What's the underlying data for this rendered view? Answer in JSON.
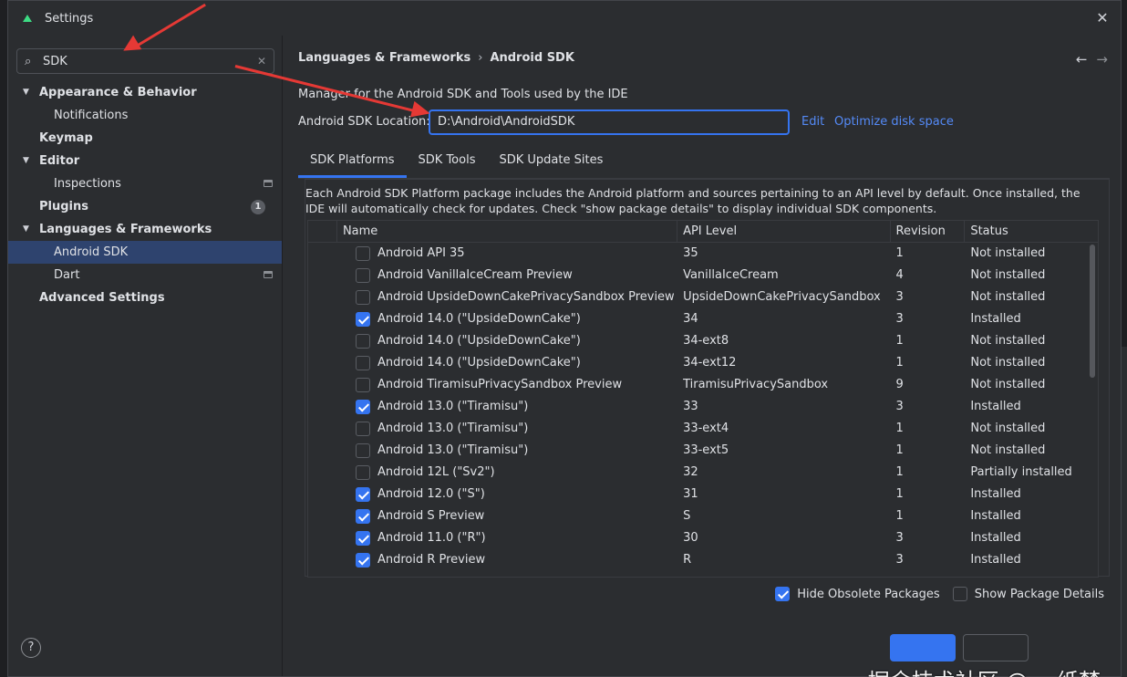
{
  "window": {
    "title": "Settings"
  },
  "search": {
    "value": "SDK"
  },
  "sidebar": {
    "items": [
      {
        "label": "Appearance & Behavior"
      },
      {
        "label": "Notifications"
      },
      {
        "label": "Keymap"
      },
      {
        "label": "Editor"
      },
      {
        "label": "Inspections"
      },
      {
        "label": "Plugins",
        "badge": "1"
      },
      {
        "label": "Languages & Frameworks"
      },
      {
        "label": "Android SDK"
      },
      {
        "label": "Dart"
      },
      {
        "label": "Advanced Settings"
      }
    ]
  },
  "breadcrumb": {
    "parent": "Languages & Frameworks",
    "separator": "›",
    "current": "Android SDK"
  },
  "main": {
    "description": "Manager for the Android SDK and Tools used by the IDE",
    "location_label": "Android SDK Location:",
    "location_value": "D:\\Android\\AndroidSDK",
    "edit_link": "Edit",
    "optimize_link": "Optimize disk space"
  },
  "tabs": [
    {
      "label": "SDK Platforms"
    },
    {
      "label": "SDK Tools"
    },
    {
      "label": "SDK Update Sites"
    }
  ],
  "panel": {
    "description": "Each Android SDK Platform package includes the Android platform and sources pertaining to an API level by default. Once installed, the IDE will automatically check for updates. Check \"show package details\" to display individual SDK components."
  },
  "table": {
    "headers": {
      "name": "Name",
      "api": "API Level",
      "revision": "Revision",
      "status": "Status"
    },
    "rows": [
      {
        "checked": false,
        "name": "Android API 35",
        "api": "35",
        "revision": "1",
        "status": "Not installed"
      },
      {
        "checked": false,
        "name": "Android VanillaIceCream Preview",
        "api": "VanillaIceCream",
        "revision": "4",
        "status": "Not installed"
      },
      {
        "checked": false,
        "name": "Android UpsideDownCakePrivacySandbox Preview",
        "api": "UpsideDownCakePrivacySandbox",
        "revision": "3",
        "status": "Not installed"
      },
      {
        "checked": true,
        "name": "Android 14.0 (\"UpsideDownCake\")",
        "api": "34",
        "revision": "3",
        "status": "Installed"
      },
      {
        "checked": false,
        "name": "Android 14.0 (\"UpsideDownCake\")",
        "api": "34-ext8",
        "revision": "1",
        "status": "Not installed"
      },
      {
        "checked": false,
        "name": "Android 14.0 (\"UpsideDownCake\")",
        "api": "34-ext12",
        "revision": "1",
        "status": "Not installed"
      },
      {
        "checked": false,
        "name": "Android TiramisuPrivacySandbox Preview",
        "api": "TiramisuPrivacySandbox",
        "revision": "9",
        "status": "Not installed"
      },
      {
        "checked": true,
        "name": "Android 13.0 (\"Tiramisu\")",
        "api": "33",
        "revision": "3",
        "status": "Installed"
      },
      {
        "checked": false,
        "name": "Android 13.0 (\"Tiramisu\")",
        "api": "33-ext4",
        "revision": "1",
        "status": "Not installed"
      },
      {
        "checked": false,
        "name": "Android 13.0 (\"Tiramisu\")",
        "api": "33-ext5",
        "revision": "1",
        "status": "Not installed"
      },
      {
        "checked": false,
        "name": "Android 12L (\"Sv2\")",
        "api": "32",
        "revision": "1",
        "status": "Partially installed"
      },
      {
        "checked": true,
        "name": "Android 12.0 (\"S\")",
        "api": "31",
        "revision": "1",
        "status": "Installed"
      },
      {
        "checked": true,
        "name": "Android S Preview",
        "api": "S",
        "revision": "1",
        "status": "Installed"
      },
      {
        "checked": true,
        "name": "Android 11.0 (\"R\")",
        "api": "30",
        "revision": "3",
        "status": "Installed"
      },
      {
        "checked": true,
        "name": "Android R Preview",
        "api": "R",
        "revision": "3",
        "status": "Installed"
      }
    ]
  },
  "options": {
    "hide_obsolete": {
      "label": "Hide Obsolete Packages",
      "checked": true
    },
    "show_details": {
      "label": "Show Package Details",
      "checked": false
    }
  },
  "watermark": "掘金技术社区 @ 一纸梦",
  "help": "?",
  "colors": {
    "accent": "#3574f0",
    "link": "#548af7",
    "selection": "#2e436e",
    "annotation": "#e53935"
  }
}
